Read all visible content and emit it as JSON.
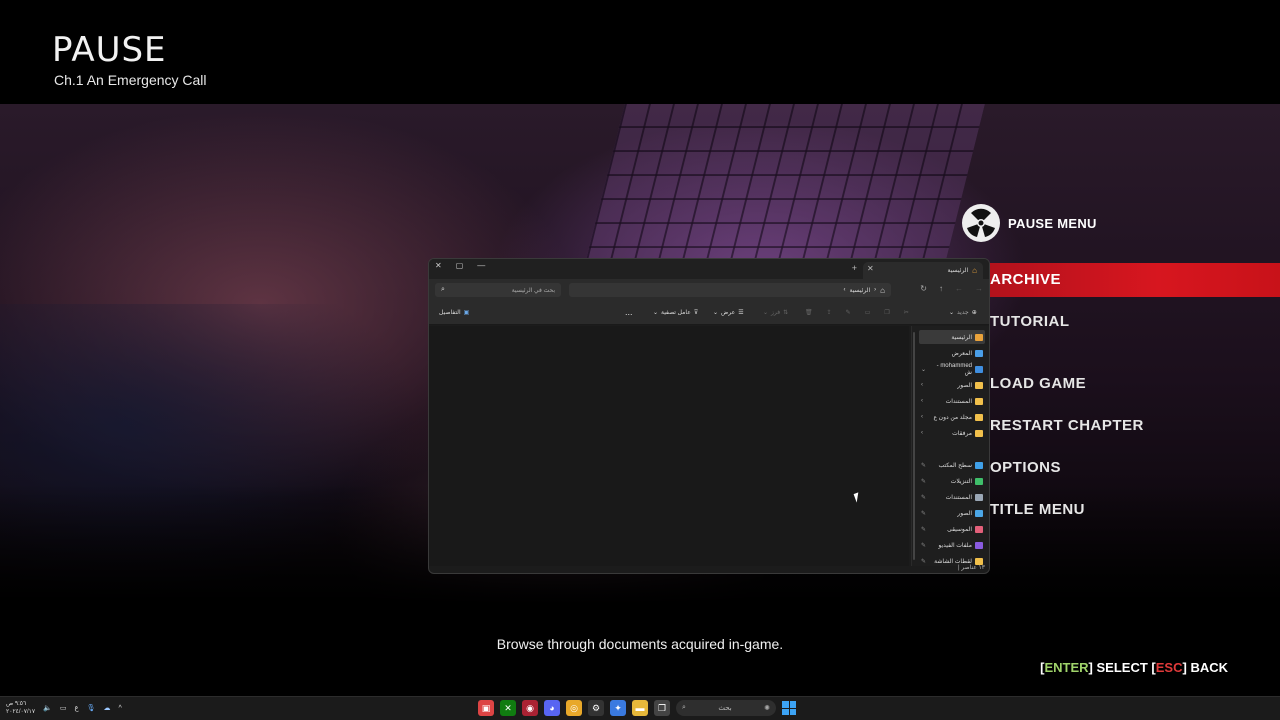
{
  "pause": {
    "title": "PAUSE",
    "chapter": "Ch.1 An Emergency Call"
  },
  "menu": {
    "header": "PAUSE MENU",
    "items": [
      "ARCHIVE",
      "TUTORIAL",
      "LOAD GAME",
      "RESTART CHAPTER",
      "OPTIONS",
      "TITLE MENU"
    ],
    "selected": "ARCHIVE"
  },
  "description": "Browse through documents acquired in-game.",
  "controls": {
    "enter": "ENTER",
    "select": "SELECT",
    "esc": "ESC",
    "back": "BACK"
  },
  "explorer": {
    "tab_label": "الرئيسية",
    "search_placeholder": "بحث في الرئيسية",
    "path": "الرئيسية",
    "toolbar": {
      "new": "جديد",
      "sort": "فرز",
      "view": "عرض",
      "filter": "عامل تصفية",
      "more": "...",
      "details": "التفاصيل"
    },
    "sidebar": [
      {
        "label": "الرئيسية",
        "icon": "home-icon",
        "color": "#e9a23b",
        "active": true
      },
      {
        "label": "المعرض",
        "icon": "gallery-icon",
        "color": "#4a9fe8"
      },
      {
        "label": "mohammed - ش",
        "icon": "cloud-icon",
        "color": "#3f8fe0",
        "chevron": "⌄"
      },
      {
        "label": "الصور",
        "icon": "folder-icon",
        "color": "#f1c04b",
        "chevron": "›"
      },
      {
        "label": "المستندات",
        "icon": "folder-icon",
        "color": "#f1c04b",
        "chevron": "›"
      },
      {
        "label": "مجلد من دون ع",
        "icon": "folder-icon",
        "color": "#f1c04b",
        "chevron": "›"
      },
      {
        "label": "مرفقات",
        "icon": "folder-icon",
        "color": "#f1c04b",
        "chevron": "›"
      },
      {
        "label": "سطح المكتب",
        "icon": "desktop-icon",
        "color": "#3fa0e8",
        "pinned": true
      },
      {
        "label": "التنزيلات",
        "icon": "download-icon",
        "color": "#3fbf6a",
        "pinned": true
      },
      {
        "label": "المستندات",
        "icon": "documents-icon",
        "color": "#9aa7b5",
        "pinned": true
      },
      {
        "label": "الصور",
        "icon": "pictures-icon",
        "color": "#4ba6e6",
        "pinned": true
      },
      {
        "label": "الموسيقى",
        "icon": "music-icon",
        "color": "#e3607a",
        "pinned": true
      },
      {
        "label": "ملفات الفيديو",
        "icon": "video-icon",
        "color": "#8a5be0",
        "pinned": true
      },
      {
        "label": "لقطات الشاشة",
        "icon": "folder-icon",
        "color": "#f1c04b",
        "pinned": true
      }
    ],
    "status": "١٣ عناصر"
  },
  "taskbar": {
    "time": "٩:٥٦ ص",
    "date": "٢٠٢٤/٠٧/١٧",
    "lang": "ع",
    "search": "بحث"
  }
}
